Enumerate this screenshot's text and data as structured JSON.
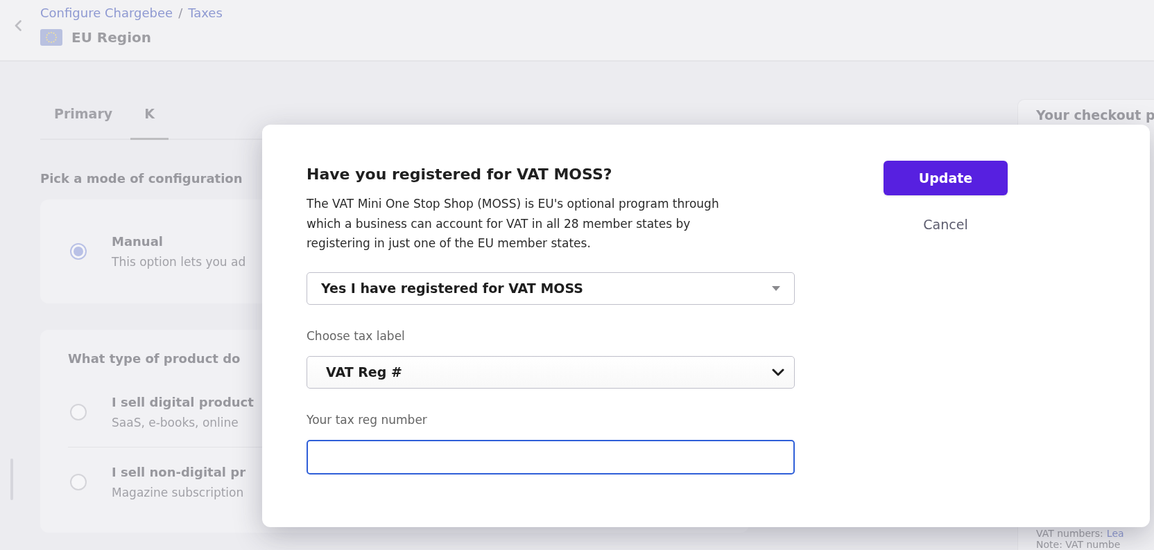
{
  "header": {
    "breadcrumb": [
      {
        "label": "Configure Chargebee"
      },
      {
        "label": "Taxes"
      }
    ],
    "separator": "/",
    "title": "EU Region"
  },
  "tabs": [
    {
      "label": "Primary",
      "selected": false
    },
    {
      "label": "K",
      "selected": true
    }
  ],
  "mode_section": {
    "heading": "Pick a mode of configuration",
    "options": [
      {
        "title": "Manual",
        "description": "This option lets you ad",
        "selected": true
      }
    ]
  },
  "product_section": {
    "heading": "What type of product do",
    "options": [
      {
        "title": "I sell digital product",
        "description": "SaaS, e-books, online",
        "selected": false
      },
      {
        "title": "I sell non-digital pr",
        "description": "Magazine subscription",
        "selected": false
      }
    ]
  },
  "checkout_panel": {
    "title": "Your checkout p",
    "notes": [
      {
        "text": "VAT numbers:",
        "link": "Lea"
      },
      {
        "text": "Note: VAT numbe"
      }
    ]
  },
  "dialog": {
    "title": "Have you registered for VAT MOSS?",
    "description": "The VAT Mini One Stop Shop (MOSS) is EU's optional program through which a business can account for VAT in all 28 member states by registering in just one of the EU member states.",
    "fields": [
      {
        "kind": "dropdown",
        "value": "Yes I have registered for VAT MOSS"
      },
      {
        "kind": "select",
        "label": "Choose tax label",
        "value": "VAT Reg #"
      },
      {
        "kind": "text",
        "label": "Your tax reg number",
        "focused": true
      }
    ],
    "buttons": [
      {
        "kind": "primary",
        "label": "Update"
      },
      {
        "kind": "link",
        "label": "Cancel"
      }
    ]
  }
}
